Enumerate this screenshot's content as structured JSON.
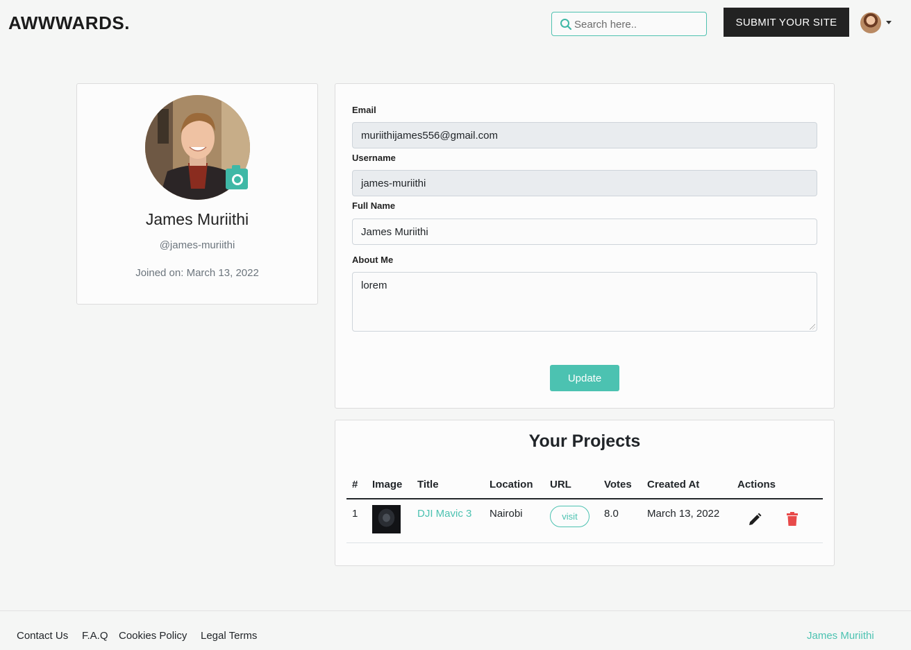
{
  "brand": "AWWWARDS.",
  "search": {
    "placeholder": "Search here.."
  },
  "nav": {
    "submit_label": "SUBMIT YOUR SITE"
  },
  "profile": {
    "name": "James Muriithi",
    "handle": "@james-muriithi",
    "joined": "Joined on: March 13, 2022"
  },
  "form": {
    "email_label": "Email",
    "email_value": "muriithijames556@gmail.com",
    "username_label": "Username",
    "username_value": "james-muriithi",
    "fullname_label": "Full Name",
    "fullname_value": "James Muriithi",
    "about_label": "About Me",
    "about_value": "lorem",
    "update_label": "Update"
  },
  "projects": {
    "title": "Your Projects",
    "headers": [
      "#",
      "Image",
      "Title",
      "Location",
      "URL",
      "Votes",
      "Created At",
      "Actions"
    ],
    "rows": [
      {
        "index": "1",
        "title": "DJI Mavic 3",
        "location": "Nairobi",
        "url_label": "visit",
        "votes": "8.0",
        "created_at": "March 13, 2022"
      }
    ]
  },
  "footer": {
    "links": [
      "Contact Us",
      "F.A.Q",
      "Cookies Policy",
      "Legal Terms"
    ],
    "author": "James Muriithi"
  },
  "colors": {
    "accent": "#4cc2b1",
    "dark": "#222222",
    "danger": "#e84a4a"
  }
}
